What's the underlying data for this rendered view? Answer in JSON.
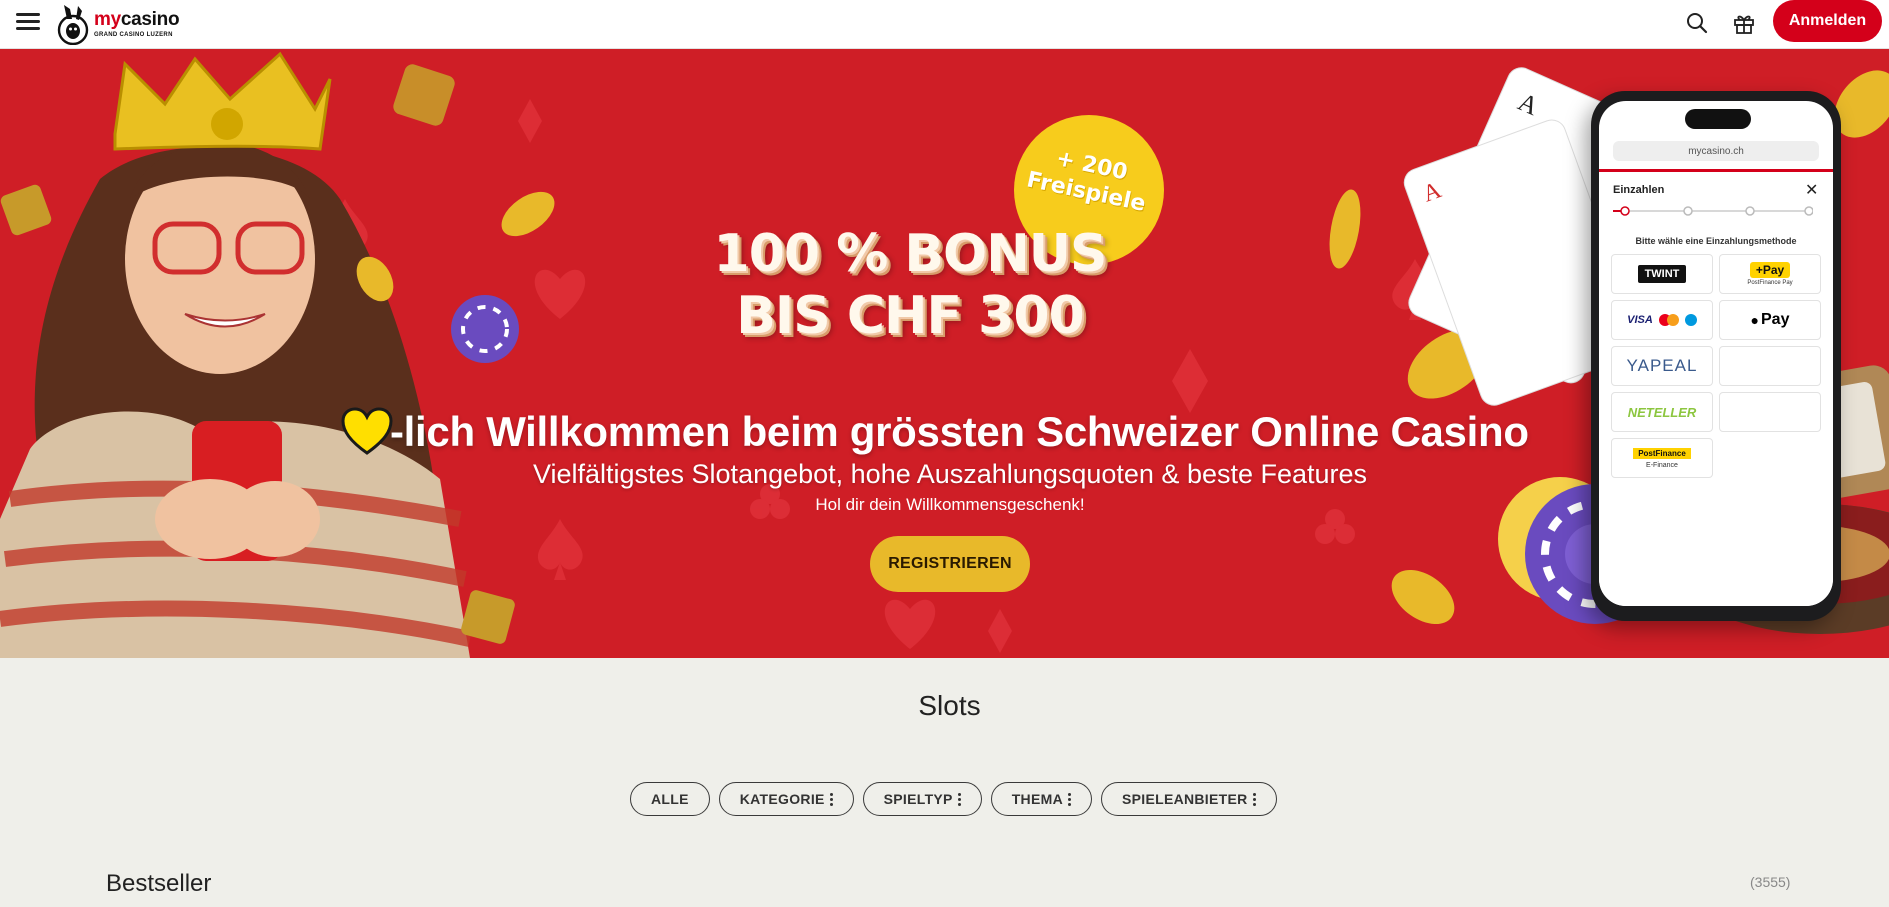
{
  "header": {
    "menu_icon": "hamburger-menu-icon",
    "logo_prefix": "my",
    "logo_name": "casino",
    "logo_sub": "GRAND CASINO LUZERN",
    "search_icon": "search-icon",
    "gift_icon": "gift-icon",
    "login_label": "Anmelden"
  },
  "hero": {
    "bonus_line1": "100 % BONUS",
    "bonus_line2": "BIS CHF 300",
    "badge_line1": "+ 200",
    "badge_line2": "Freispiele",
    "heart_icon": "yellow-heart-icon",
    "welcome": "-lich Willkommen beim grössten Schweizer Online Casino",
    "subline": "Vielfältigstes Slotangebot, hohe Auszahlungsquoten & beste Features",
    "smallline": "Hol dir dein Willkommensgeschenk!",
    "register_label": "REGISTRIEREN",
    "phone": {
      "url": "mycasino.ch",
      "title": "Einzahlen",
      "hint": "Bitte wähle eine Einzahlungsmethode",
      "methods": [
        "TWINT",
        "Pay",
        "VISA",
        "Pay",
        "YAPEAL",
        "",
        "NETELLER",
        "",
        "PostFinance",
        ""
      ],
      "postfinance_pay_label": "PostFinance Pay",
      "efinance_label": "E-Finance"
    }
  },
  "slots": {
    "title": "Slots",
    "filters": [
      {
        "label": "ALLE",
        "menu": false
      },
      {
        "label": "KATEGORIE",
        "menu": true
      },
      {
        "label": "SPIELTYP",
        "menu": true
      },
      {
        "label": "THEMA",
        "menu": true
      },
      {
        "label": "SPIELEANBIETER",
        "menu": true
      }
    ],
    "section_title": "Bestseller",
    "count": "(3555)"
  },
  "colors": {
    "brand_red": "#d4001a",
    "hero_red": "#cf1e26",
    "gold": "#e8b92a",
    "badge_yellow": "#f7cc1c"
  }
}
